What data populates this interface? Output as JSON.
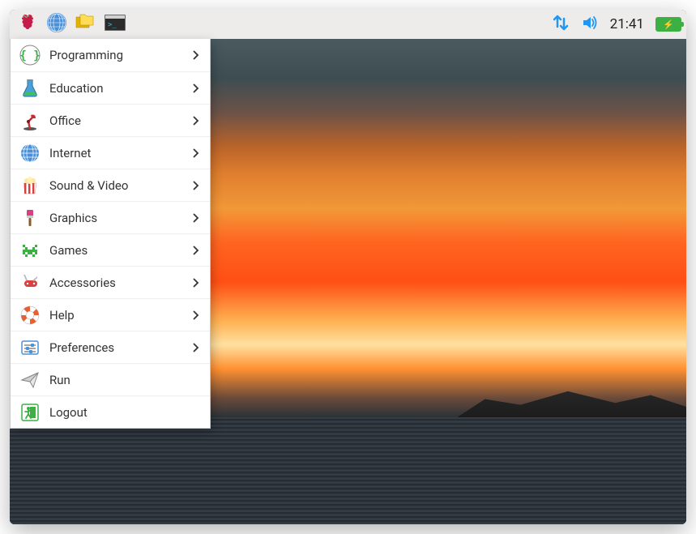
{
  "taskbar": {
    "clock": "21:41"
  },
  "menu": {
    "items": [
      {
        "label": "Programming",
        "hasSubmenu": true
      },
      {
        "label": "Education",
        "hasSubmenu": true
      },
      {
        "label": "Office",
        "hasSubmenu": true
      },
      {
        "label": "Internet",
        "hasSubmenu": true
      },
      {
        "label": "Sound & Video",
        "hasSubmenu": true
      },
      {
        "label": "Graphics",
        "hasSubmenu": true
      },
      {
        "label": "Games",
        "hasSubmenu": true
      },
      {
        "label": "Accessories",
        "hasSubmenu": true
      },
      {
        "label": "Help",
        "hasSubmenu": true
      },
      {
        "label": "Preferences",
        "hasSubmenu": true
      },
      {
        "label": "Run",
        "hasSubmenu": false
      },
      {
        "label": "Logout",
        "hasSubmenu": false
      }
    ]
  }
}
